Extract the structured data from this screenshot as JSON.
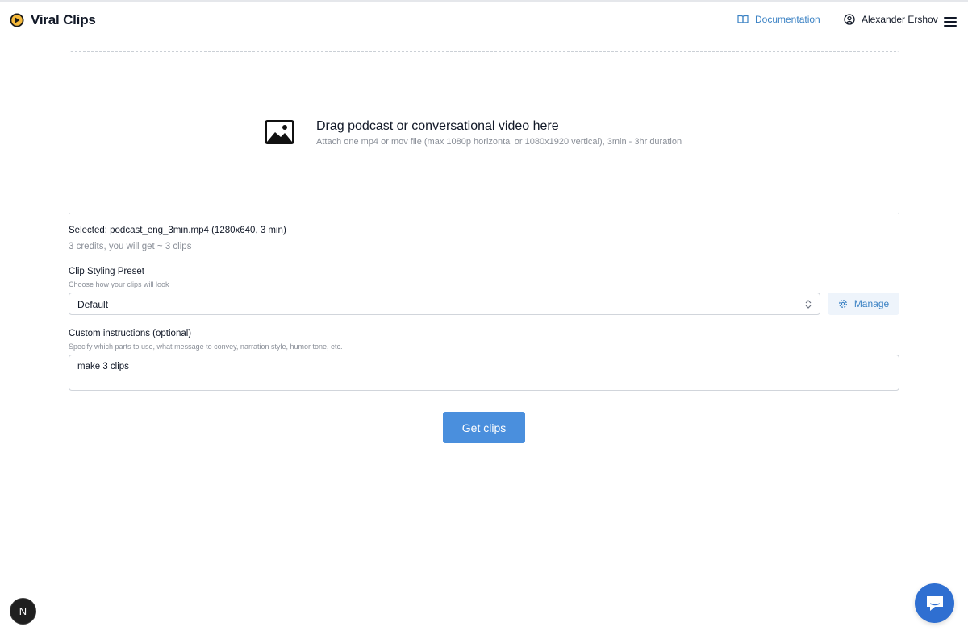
{
  "header": {
    "app_title": "Viral Clips",
    "documentation_label": "Documentation",
    "user_name": "Alexander Ershov"
  },
  "dropzone": {
    "title": "Drag podcast or conversational video here",
    "subtitle": "Attach one mp4 or mov file (max 1080p horizontal or 1080x1920 vertical), 3min - 3hr duration"
  },
  "selection": {
    "selected_text": "Selected: podcast_eng_3min.mp4 (1280x640, 3 min)",
    "credits_text": "3 credits, you will get ~ 3 clips"
  },
  "preset": {
    "label": "Clip Styling Preset",
    "hint": "Choose how your clips will look",
    "selected_value": "Default",
    "manage_label": "Manage"
  },
  "instructions": {
    "label": "Custom instructions (optional)",
    "hint": "Specify which parts to use, what message to convey, narration style, humor tone, etc.",
    "value": "make 3 clips"
  },
  "submit_label": "Get clips",
  "next_badge": "N",
  "colors": {
    "accent": "#4a8fdd",
    "link": "#3b82c4",
    "chat": "#2f6fd1",
    "logo": "#f5b93b"
  }
}
